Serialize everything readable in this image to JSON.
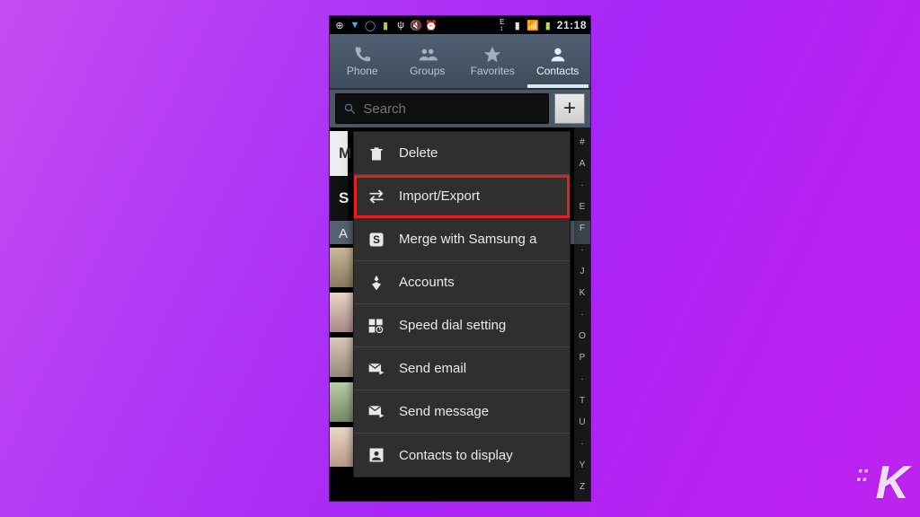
{
  "statusbar": {
    "time": "21:18"
  },
  "tabs": {
    "phone": "Phone",
    "groups": "Groups",
    "favorites": "Favorites",
    "contacts": "Contacts"
  },
  "search": {
    "placeholder": "Search"
  },
  "add_label": "+",
  "alpha_index": [
    "#",
    "A",
    "·",
    "E",
    "F",
    "·",
    "J",
    "K",
    "·",
    "O",
    "P",
    "·",
    "T",
    "U",
    "·",
    "Y",
    "Z"
  ],
  "bg_hints": {
    "m": "M",
    "s": "S",
    "a": "A"
  },
  "menu": {
    "delete": "Delete",
    "import_export": "Import/Export",
    "merge": "Merge with Samsung a",
    "accounts": "Accounts",
    "speed_dial": "Speed dial setting",
    "send_email": "Send email",
    "send_message": "Send message",
    "contacts_display": "Contacts to display"
  },
  "watermark": "K"
}
